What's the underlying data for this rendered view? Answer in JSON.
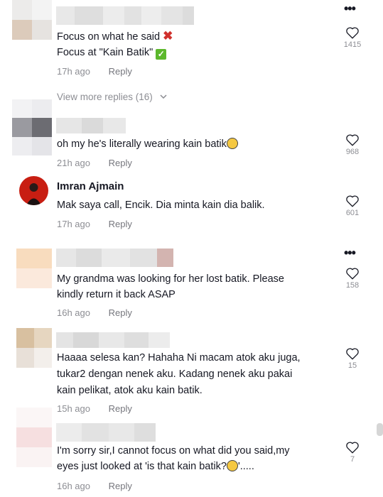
{
  "comments": [
    {
      "text1": "Focus on what he said",
      "text2": "Focus at \"Kain Batik\"",
      "time": "17h ago",
      "reply": "Reply",
      "likes": "1415",
      "icons": [
        "cross-mark-emoji",
        "check-mark-emoji"
      ]
    },
    {
      "text": "oh my he's literally wearing kain batik",
      "time": "21h ago",
      "reply": "Reply",
      "likes": "968",
      "icons": [
        "smiling-face-emoji"
      ]
    },
    {
      "name": "Imran Ajmain",
      "text": "Mak saya call, Encik. Dia minta kain dia balik.",
      "time": "17h ago",
      "reply": "Reply",
      "likes": "601"
    },
    {
      "text1": "My grandma was looking for her lost batik. Please",
      "text2": "kindly return it back ASAP",
      "time": "16h ago",
      "reply": "Reply",
      "likes": "158"
    },
    {
      "text1": "Haaaa selesa kan? Hahaha Ni macam atok aku juga,",
      "text2": "tukar2 dengan nenek aku. Kadang nenek aku pakai",
      "text3": "kain pelikat, atok aku kain batik.",
      "time": "15h ago",
      "reply": "Reply",
      "likes": "15"
    },
    {
      "text1": "I'm sorry sir,I cannot focus on what did you said,my",
      "text2a": "eyes just looked at 'is that kain batik?",
      "text2b": "'.....",
      "time": "16h ago",
      "reply": "Reply",
      "likes": "7",
      "icons": [
        "grinning-sweat-emoji"
      ]
    }
  ],
  "view_more": "View more replies (16)",
  "icons": {
    "like": "heart-outline-icon",
    "more": "more-dots-icon",
    "expand": "chevron-down-icon"
  }
}
